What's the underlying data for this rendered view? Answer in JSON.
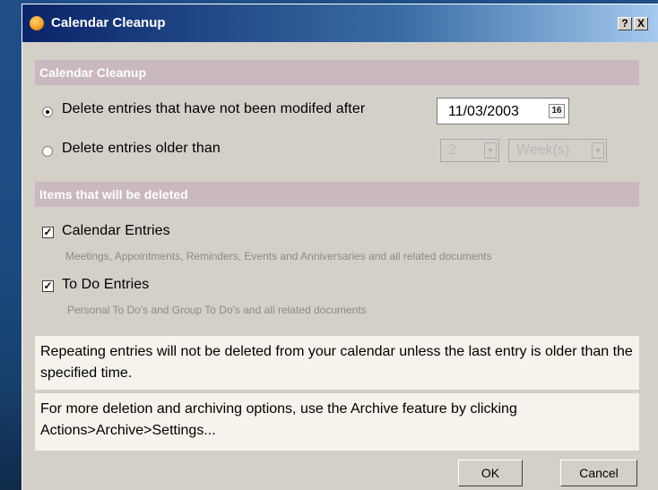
{
  "window": {
    "title": "Calendar Cleanup",
    "help_label": "?",
    "close_label": "X"
  },
  "section1": {
    "header": "Calendar Cleanup",
    "option1_label": "Delete entries that have not been modifed after",
    "option1_checked": true,
    "date_value": "11/03/2003",
    "calendar_icon_label": "16",
    "option2_label": "Delete entries older than",
    "option2_checked": false,
    "count_value": "2",
    "unit_value": "Week(s)"
  },
  "section2": {
    "header": "Items that will be deleted",
    "calendar_entries_label": "Calendar Entries",
    "calendar_entries_checked": true,
    "calendar_entries_desc": "Meetings, Appointments, Reminders, Events and Anniversaries and all related documents",
    "todo_entries_label": "To Do Entries",
    "todo_entries_checked": true,
    "todo_entries_desc": "Personal To Do's and Group To Do's and all related documents"
  },
  "notes": {
    "repeating": "Repeating entries will not be deleted from your calendar unless the last entry is older than the specified time.",
    "archive": "For more deletion and archiving options, use the Archive feature by clicking Actions>Archive>Settings..."
  },
  "buttons": {
    "ok": "OK",
    "cancel": "Cancel"
  }
}
